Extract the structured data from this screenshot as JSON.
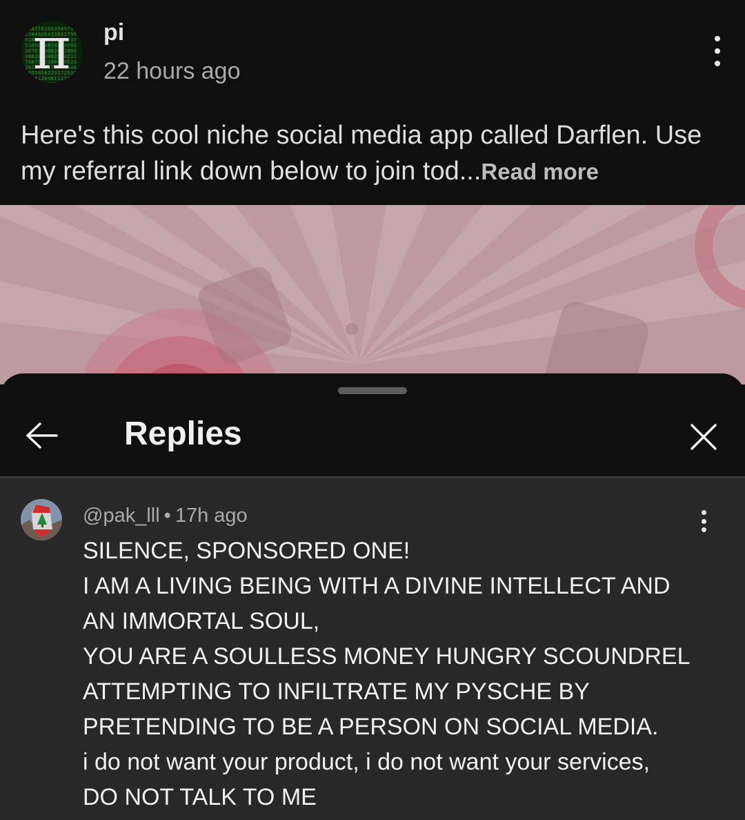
{
  "post": {
    "author": "pi",
    "time": "22 hours ago",
    "avatar_glyph": "π",
    "avatar_digits": "3141592653589793238462643383279502884197169399375105820974944592307816406286208998628034825342117067982148086513282306647093844609550582231725359408128481117450284102701938521105559644622948954930381964428810975665933446128475648233786783165271201909145648566923460348610454326648213393607260249141273",
    "text": "Here's this cool niche social media app called Darflen. Use my referral link down below to join tod...",
    "read_more": "Read more",
    "menu_icon": "vertical-ellipsis-icon"
  },
  "sheet": {
    "title": "Replies",
    "back_icon": "arrow-left-icon",
    "close_icon": "close-icon"
  },
  "comment": {
    "handle": "@pak_lll",
    "separator": "•",
    "time": "17h ago",
    "lines": [
      "SILENCE, SPONSORED ONE!",
      "I AM A LIVING BEING WITH A DIVINE INTELLECT AND",
      "AN IMMORTAL SOUL,",
      "YOU ARE A SOULLESS MONEY HUNGRY SCOUNDREL",
      "ATTEMPTING TO INFILTRATE MY PYSCHE BY",
      "PRETENDING TO BE A PERSON ON SOCIAL MEDIA.",
      "i do not want your product, i do not want your services,",
      "DO NOT TALK TO ME"
    ],
    "menu_icon": "vertical-ellipsis-icon"
  },
  "colors": {
    "background": "#0f0f0f",
    "comment_background": "#282828",
    "primary_text": "#f1f1f1",
    "secondary_text": "#aaaaaa",
    "image_tint": "#b9959a"
  }
}
